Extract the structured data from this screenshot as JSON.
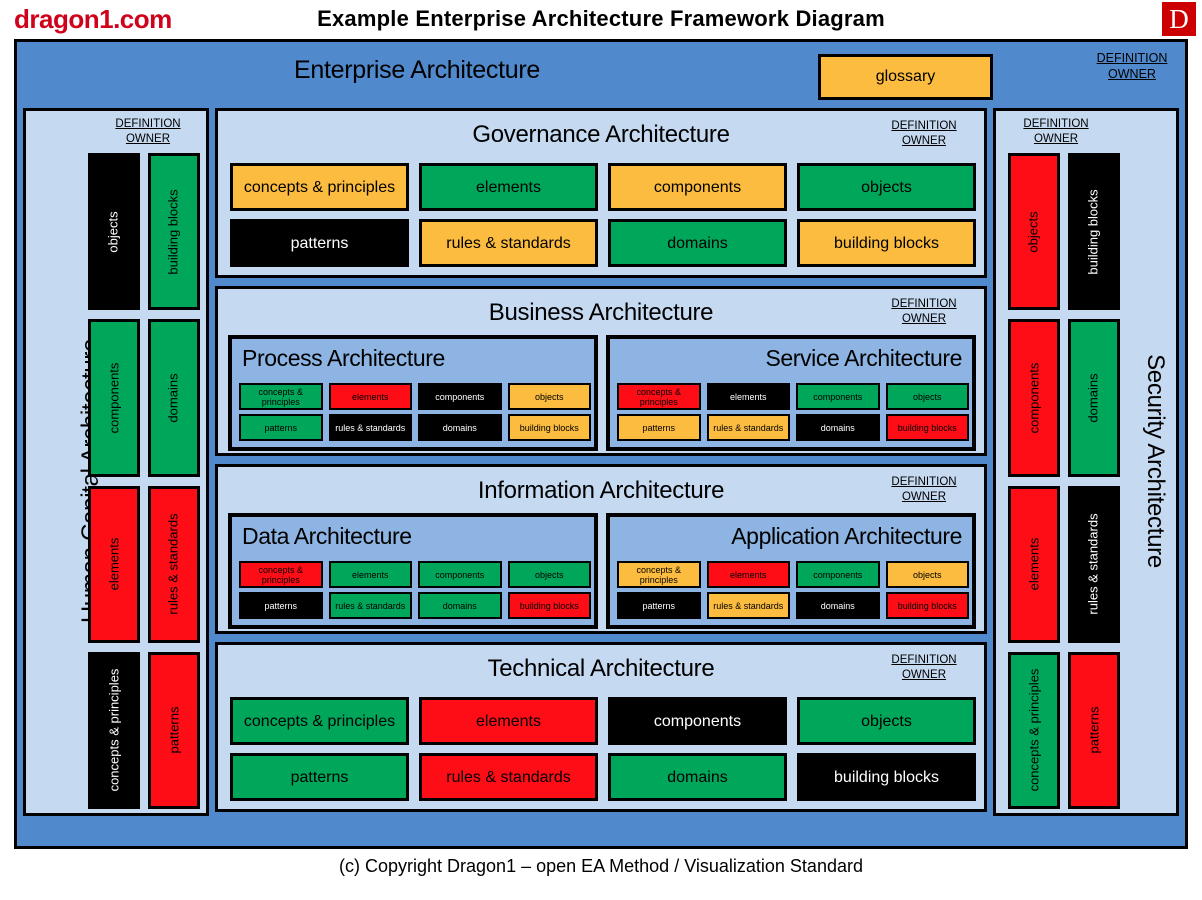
{
  "header": {
    "brand": "dragon1.com",
    "title": "Example Enterprise Architecture Framework Diagram",
    "badge": "D"
  },
  "footer": {
    "copyright": "(c) Copyright Dragon1 – open EA Method / Visualization  Standard"
  },
  "labels": {
    "definition": "DEFINITION",
    "owner": "OWNER"
  },
  "colors": {
    "outer_blue": "#5089CC",
    "panel_blue": "#C5D9F1",
    "sub_panel_blue": "#8DB4E2",
    "green": "#00A65A",
    "orange": "#FBBC3F",
    "red": "#FE0D17",
    "black": "#000000",
    "brand_red": "#D0021B",
    "badge_red": "#CC0000"
  },
  "enterprise": {
    "title": "Enterprise Architecture",
    "glossary": "glossary"
  },
  "human_capital": {
    "title": "Human Capital Architecture",
    "blocks": [
      {
        "label": "objects",
        "color": "black"
      },
      {
        "label": "building blocks",
        "color": "green"
      },
      {
        "label": "components",
        "color": "green"
      },
      {
        "label": "domains",
        "color": "green"
      },
      {
        "label": "elements",
        "color": "red"
      },
      {
        "label": "rules & standards",
        "color": "red"
      },
      {
        "label": "concepts & principles",
        "color": "black"
      },
      {
        "label": "patterns",
        "color": "red"
      }
    ]
  },
  "security": {
    "title": "Security Architecture",
    "blocks": [
      {
        "label": "objects",
        "color": "red"
      },
      {
        "label": "building blocks",
        "color": "black"
      },
      {
        "label": "components",
        "color": "red"
      },
      {
        "label": "domains",
        "color": "green"
      },
      {
        "label": "elements",
        "color": "red"
      },
      {
        "label": "rules & standards",
        "color": "black"
      },
      {
        "label": "concepts & principles",
        "color": "green"
      },
      {
        "label": "patterns",
        "color": "red"
      }
    ]
  },
  "governance": {
    "title": "Governance Architecture",
    "blocks": [
      {
        "label": "concepts & principles",
        "color": "orange"
      },
      {
        "label": "elements",
        "color": "green"
      },
      {
        "label": "components",
        "color": "orange"
      },
      {
        "label": "objects",
        "color": "green"
      },
      {
        "label": "patterns",
        "color": "black"
      },
      {
        "label": "rules & standards",
        "color": "orange"
      },
      {
        "label": "domains",
        "color": "green"
      },
      {
        "label": "building blocks",
        "color": "orange"
      }
    ]
  },
  "technical": {
    "title": "Technical Architecture",
    "blocks": [
      {
        "label": "concepts & principles",
        "color": "green"
      },
      {
        "label": "elements",
        "color": "red"
      },
      {
        "label": "components",
        "color": "black"
      },
      {
        "label": "objects",
        "color": "green"
      },
      {
        "label": "patterns",
        "color": "green"
      },
      {
        "label": "rules & standards",
        "color": "red"
      },
      {
        "label": "domains",
        "color": "green"
      },
      {
        "label": "building blocks",
        "color": "black"
      }
    ]
  },
  "business": {
    "title": "Business Architecture",
    "process": {
      "title": "Process Architecture",
      "blocks": [
        {
          "label": "concepts & principles",
          "color": "green"
        },
        {
          "label": "elements",
          "color": "red"
        },
        {
          "label": "components",
          "color": "black"
        },
        {
          "label": "objects",
          "color": "orange"
        },
        {
          "label": "patterns",
          "color": "green"
        },
        {
          "label": "rules & standards",
          "color": "black"
        },
        {
          "label": "domains",
          "color": "black"
        },
        {
          "label": "building blocks",
          "color": "orange"
        }
      ]
    },
    "service": {
      "title": "Service Architecture",
      "blocks": [
        {
          "label": "concepts & principles",
          "color": "red"
        },
        {
          "label": "elements",
          "color": "black"
        },
        {
          "label": "components",
          "color": "green"
        },
        {
          "label": "objects",
          "color": "green"
        },
        {
          "label": "patterns",
          "color": "orange"
        },
        {
          "label": "rules & standards",
          "color": "orange"
        },
        {
          "label": "domains",
          "color": "black"
        },
        {
          "label": "building blocks",
          "color": "red"
        }
      ]
    }
  },
  "information": {
    "title": "Information Architecture",
    "data": {
      "title": "Data Architecture",
      "blocks": [
        {
          "label": "concepts & principles",
          "color": "red"
        },
        {
          "label": "elements",
          "color": "green"
        },
        {
          "label": "components",
          "color": "green"
        },
        {
          "label": "objects",
          "color": "green"
        },
        {
          "label": "patterns",
          "color": "black"
        },
        {
          "label": "rules & standards",
          "color": "green"
        },
        {
          "label": "domains",
          "color": "green"
        },
        {
          "label": "building blocks",
          "color": "red"
        }
      ]
    },
    "application": {
      "title": "Application Architecture",
      "blocks": [
        {
          "label": "concepts & principles",
          "color": "orange"
        },
        {
          "label": "elements",
          "color": "red"
        },
        {
          "label": "components",
          "color": "green"
        },
        {
          "label": "objects",
          "color": "orange"
        },
        {
          "label": "patterns",
          "color": "black"
        },
        {
          "label": "rules & standards",
          "color": "orange"
        },
        {
          "label": "domains",
          "color": "black"
        },
        {
          "label": "building blocks",
          "color": "red"
        }
      ]
    }
  }
}
